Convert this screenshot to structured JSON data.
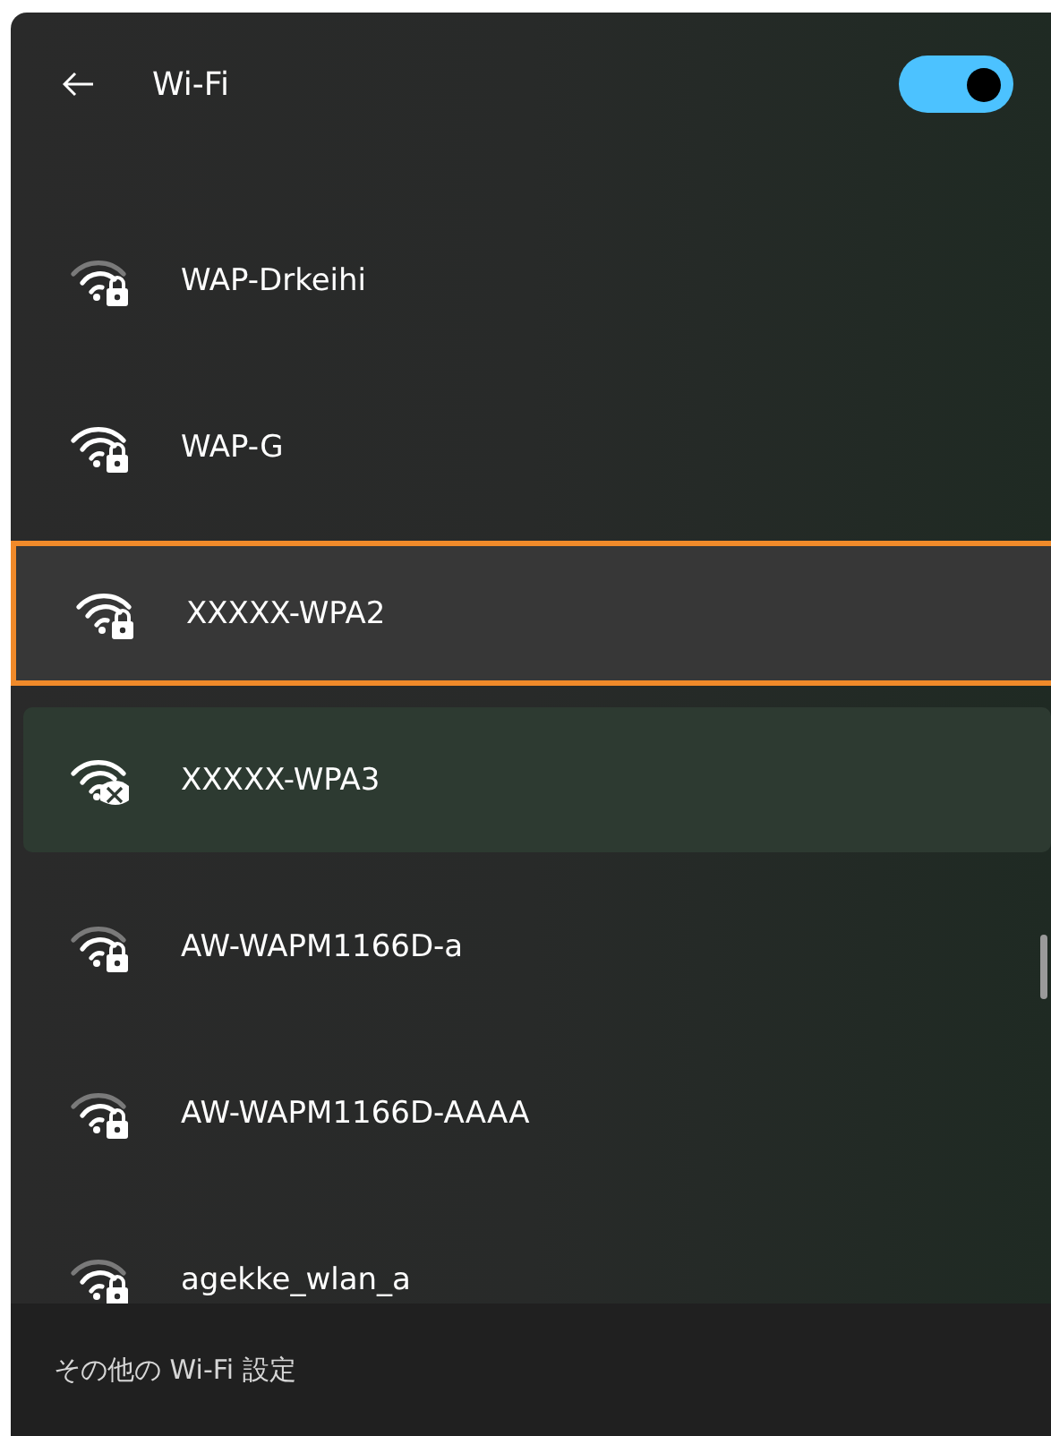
{
  "header": {
    "title": "Wi-Fi",
    "wifi_on": true
  },
  "networks": [
    {
      "name": "WAP-Drkeihi",
      "kind": "secured",
      "full_signal": false,
      "focused": false,
      "selected": false
    },
    {
      "name": "WAP-G",
      "kind": "secured",
      "full_signal": true,
      "focused": false,
      "selected": false
    },
    {
      "name": "XXXXX-WPA2",
      "kind": "secured",
      "full_signal": true,
      "focused": true,
      "selected": false
    },
    {
      "name": "XXXXX-WPA3",
      "kind": "warning",
      "full_signal": true,
      "focused": false,
      "selected": true
    },
    {
      "name": "AW-WAPM1166D-a",
      "kind": "secured",
      "full_signal": false,
      "focused": false,
      "selected": false
    },
    {
      "name": "AW-WAPM1166D-AAAA",
      "kind": "secured",
      "full_signal": false,
      "focused": false,
      "selected": false
    },
    {
      "name": "agekke_wlan_a",
      "kind": "secured",
      "full_signal": false,
      "focused": false,
      "selected": false
    }
  ],
  "footer": {
    "link": "その他の Wi-Fi 設定"
  }
}
